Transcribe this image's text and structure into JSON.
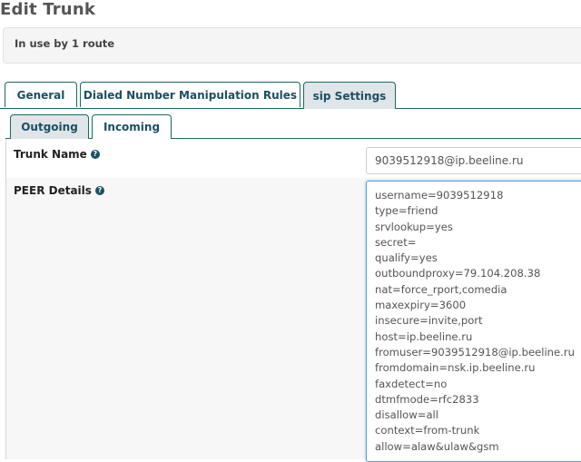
{
  "page": {
    "title": "Edit Trunk"
  },
  "usage": {
    "text": "In use by 1 route"
  },
  "tabs": [
    {
      "label": "General",
      "active": false
    },
    {
      "label": "Dialed Number Manipulation Rules",
      "active": false
    },
    {
      "label": "sip Settings",
      "active": true
    }
  ],
  "subtabs": [
    {
      "label": "Outgoing",
      "active": true
    },
    {
      "label": "Incoming",
      "active": false
    }
  ],
  "fields": {
    "trunk_name": {
      "label": "Trunk Name",
      "value": "9039512918@ip.beeline.ru"
    },
    "peer_details": {
      "label": "PEER Details",
      "lines": [
        "username=9039512918",
        "type=friend",
        "srvlookup=yes",
        "secret=",
        "qualify=yes",
        "outboundproxy=79.104.208.38",
        "nat=force_rport,comedia",
        "maxexpiry=3600",
        "insecure=invite,port",
        "host=ip.beeline.ru",
        "fromuser=9039512918@ip.beeline.ru",
        "fromdomain=nsk.ip.beeline.ru",
        "faxdetect=no",
        "dtmfmode=rfc2833",
        "disallow=all",
        "context=from-trunk",
        "allow=alaw&ulaw&gsm"
      ]
    }
  },
  "icons": {
    "help": "help-circle-icon"
  },
  "colors": {
    "accent": "#1d4f60",
    "tab_border": "#1a6b5e",
    "active_tab_bg": "#dfe5e9"
  }
}
